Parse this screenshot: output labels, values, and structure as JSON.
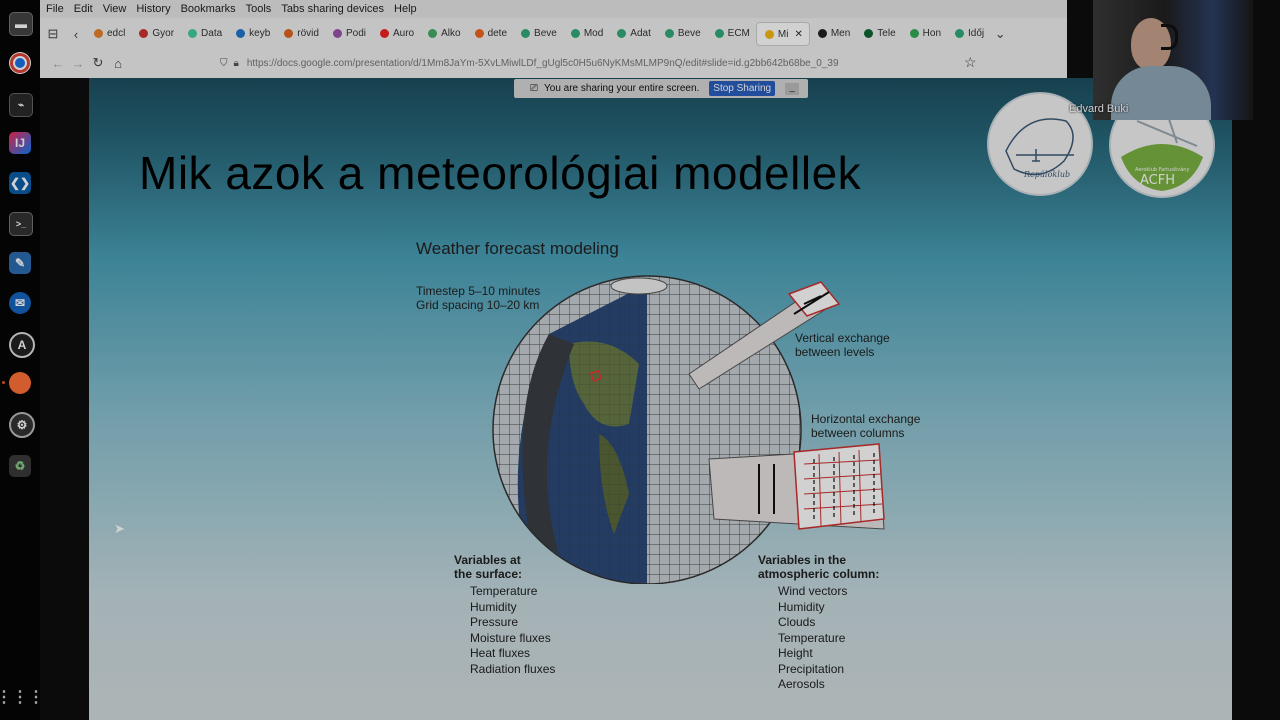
{
  "browser": {
    "menu": [
      "File",
      "Edit",
      "View",
      "History",
      "Bookmarks",
      "Tools",
      "Tabs sharing devices",
      "Help"
    ],
    "tabs": [
      {
        "label": "edcl",
        "color": "#e8812d"
      },
      {
        "label": "Gyor",
        "color": "#c33"
      },
      {
        "label": "Data",
        "color": "#4c9"
      },
      {
        "label": "keyb",
        "color": "#27c"
      },
      {
        "label": "rövid",
        "color": "#d62"
      },
      {
        "label": "Podi",
        "color": "#95a"
      },
      {
        "label": "Auro",
        "color": "#e22"
      },
      {
        "label": "Alko",
        "color": "#4a6"
      },
      {
        "label": "dete",
        "color": "#e62"
      },
      {
        "label": "Beve",
        "color": "#3a7"
      },
      {
        "label": "Mod",
        "color": "#3a7"
      },
      {
        "label": "Adat",
        "color": "#3a7"
      },
      {
        "label": "Beve",
        "color": "#3a7"
      },
      {
        "label": "ECM",
        "color": "#3a7"
      },
      {
        "label": "Mi",
        "color": "#f5ba14",
        "active": true
      },
      {
        "label": "Men",
        "color": "#222"
      },
      {
        "label": "Tele",
        "color": "#163"
      },
      {
        "label": "Hon",
        "color": "#3a5"
      },
      {
        "label": "Időj",
        "color": "#3a7"
      }
    ],
    "url": "https://docs.google.com/presentation/d/1Mm8JaYm-5XvLMiwlLDf_gUgl5c0H5u6NyKMsMLMP9nQ/edit#slide=id.g2bb642b68be_0_39"
  },
  "share_bar": {
    "text": "You are sharing your entire screen.",
    "stop_label": "Stop Sharing",
    "hide_label": "_"
  },
  "slide": {
    "title": "Mik azok a meteorológiai modellek",
    "figure": {
      "title": "Weather forecast modeling",
      "timestep": "Timestep 5–10 minutes",
      "grid": "Grid spacing 10–20 km",
      "vertical_1": "Vertical exchange",
      "vertical_2": "between levels",
      "horizontal_1": "Horizontal exchange",
      "horizontal_2": "between columns",
      "surface_head_1": "Variables at",
      "surface_head_2": "the surface:",
      "surface_vars": [
        "Temperature",
        "Humidity",
        "Pressure",
        "Moisture fluxes",
        "Heat fluxes",
        "Radiation fluxes"
      ],
      "column_head_1": "Variables in the",
      "column_head_2": "atmospheric column:",
      "column_vars": [
        "Wind vectors",
        "Humidity",
        "Clouds",
        "Temperature",
        "Height",
        "Precipitation",
        "Aerosols"
      ]
    },
    "logos": {
      "left_text": "Repülőklub",
      "right_top": "Aeroklub Fartusítvány",
      "right_main": "ACFH"
    }
  },
  "webcam": {
    "name": "Edvard Buki"
  }
}
